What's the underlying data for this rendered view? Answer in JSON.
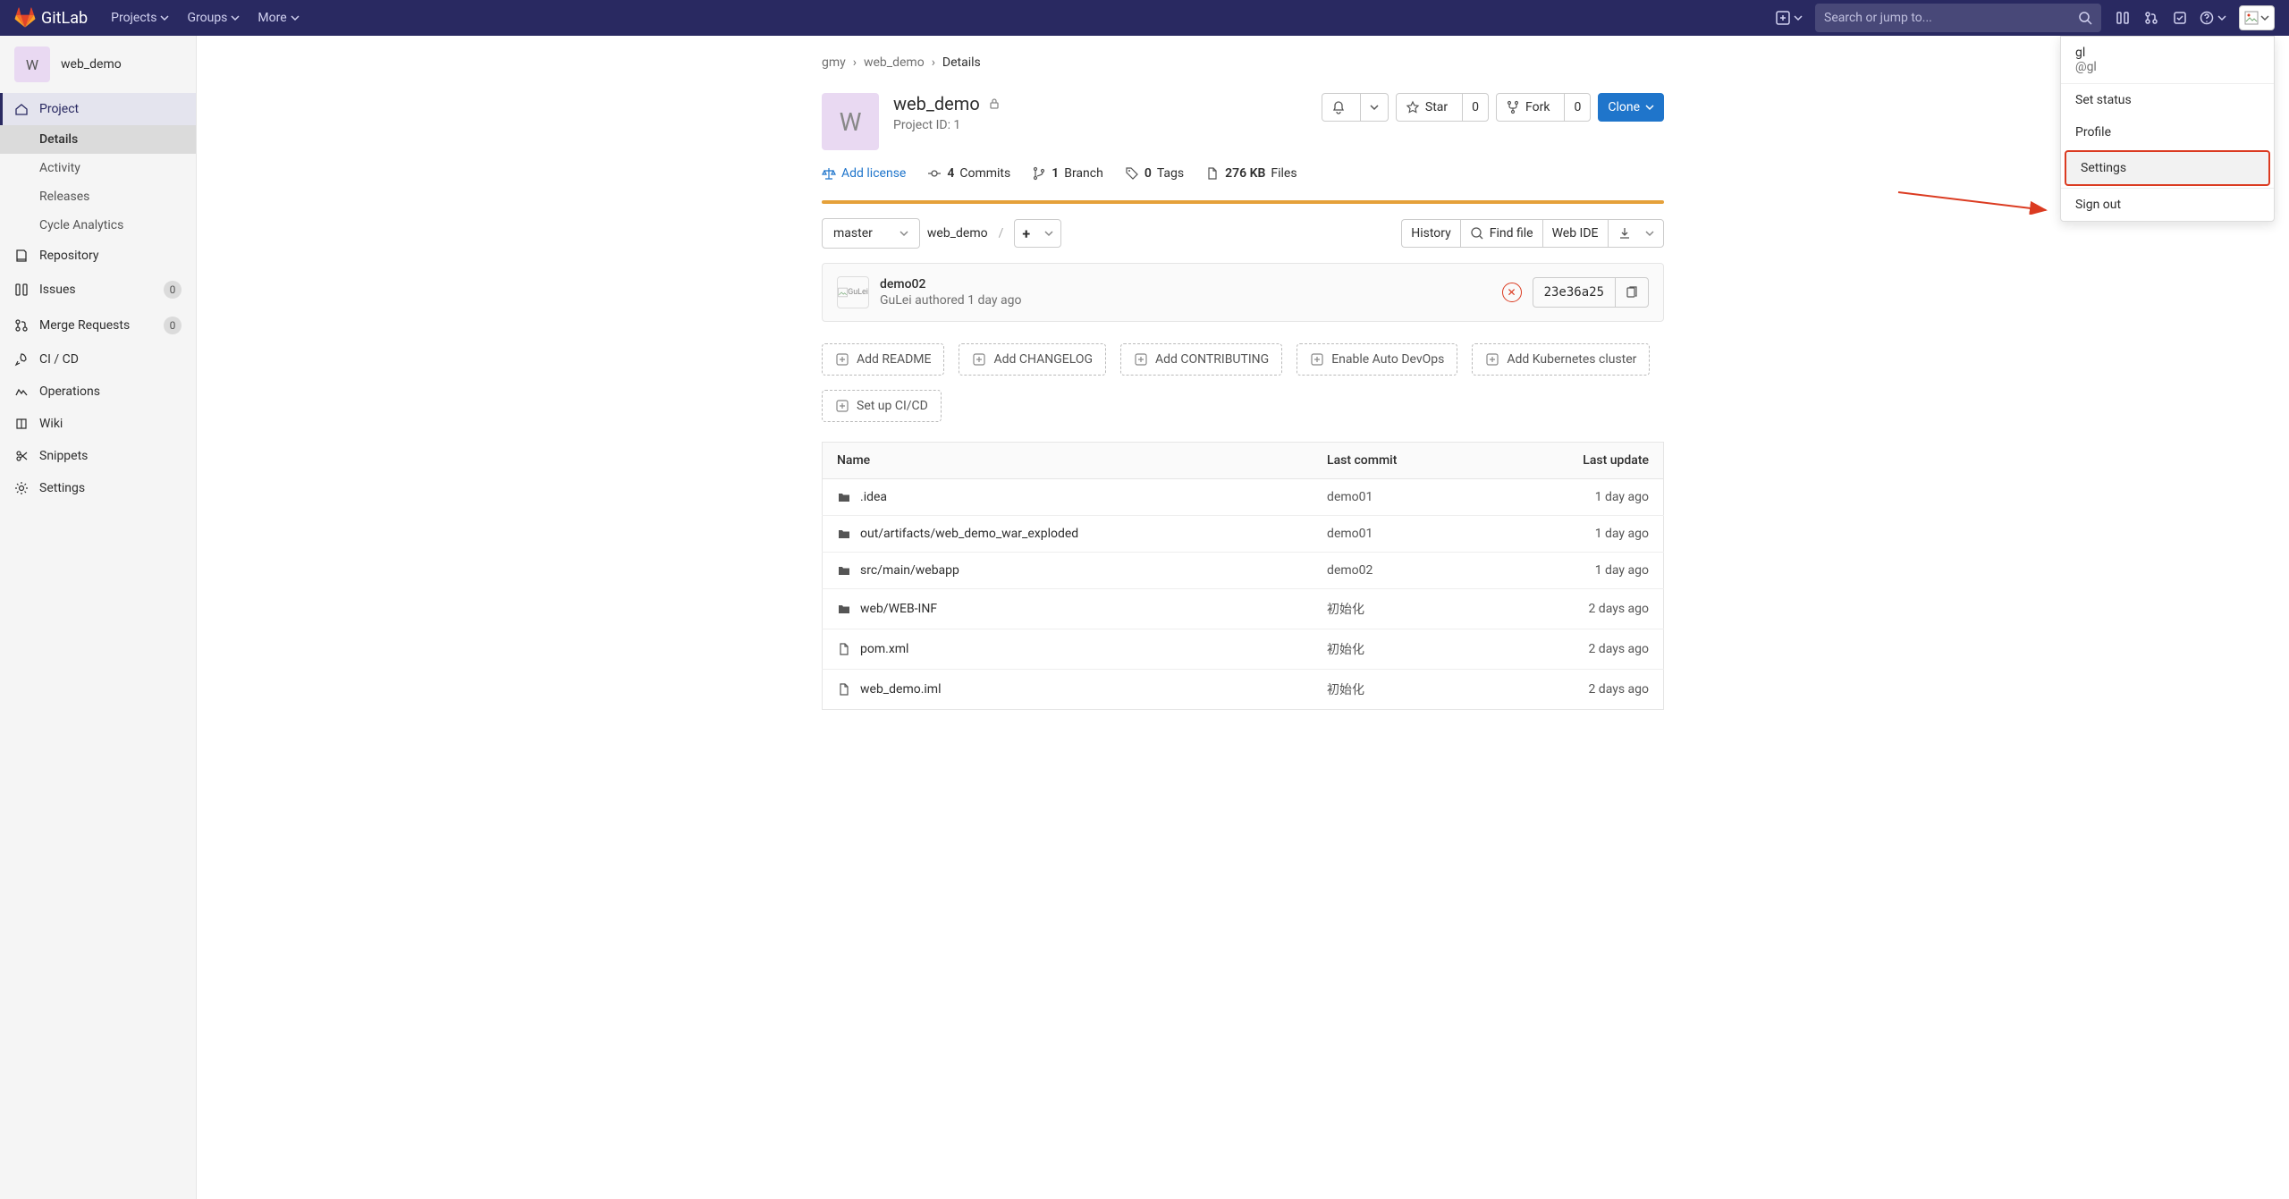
{
  "topnav": {
    "brand": "GitLab",
    "items": [
      "Projects",
      "Groups",
      "More"
    ],
    "search_placeholder": "Search or jump to..."
  },
  "sidebar": {
    "project_initial": "W",
    "project_name": "web_demo",
    "groups": [
      {
        "icon": "home",
        "label": "Project",
        "active": true,
        "subs": [
          {
            "label": "Details",
            "active": true
          },
          {
            "label": "Activity"
          },
          {
            "label": "Releases"
          },
          {
            "label": "Cycle Analytics"
          }
        ]
      },
      {
        "icon": "repo",
        "label": "Repository"
      },
      {
        "icon": "issues",
        "label": "Issues",
        "count": "0"
      },
      {
        "icon": "mr",
        "label": "Merge Requests",
        "count": "0"
      },
      {
        "icon": "rocket",
        "label": "CI / CD"
      },
      {
        "icon": "ops",
        "label": "Operations"
      },
      {
        "icon": "book",
        "label": "Wiki"
      },
      {
        "icon": "scissors",
        "label": "Snippets"
      },
      {
        "icon": "gear",
        "label": "Settings"
      }
    ]
  },
  "breadcrumbs": {
    "a": "gmy",
    "b": "web_demo",
    "c": "Details"
  },
  "hero": {
    "initial": "W",
    "title": "web_demo",
    "project_id": "Project ID: 1",
    "star": "Star",
    "star_count": "0",
    "fork": "Fork",
    "fork_count": "0",
    "clone": "Clone"
  },
  "stats": {
    "add_license": "Add license",
    "commits_n": "4",
    "commits_w": "Commits",
    "branch_n": "1",
    "branch_w": "Branch",
    "tags_n": "0",
    "tags_w": "Tags",
    "size_n": "276 KB",
    "size_w": "Files"
  },
  "toolbar": {
    "branch": "master",
    "project": "web_demo",
    "history": "History",
    "find": "Find file",
    "ide": "Web IDE"
  },
  "commit": {
    "title": "demo02",
    "author": "GuLei",
    "authored": "authored",
    "time": "1 day ago",
    "avatar_alt": "GuLei",
    "sha": "23e36a25"
  },
  "chips": [
    "Add README",
    "Add CHANGELOG",
    "Add CONTRIBUTING",
    "Enable Auto DevOps",
    "Add Kubernetes cluster",
    "Set up CI/CD"
  ],
  "table": {
    "cols": [
      "Name",
      "Last commit",
      "Last update"
    ],
    "rows": [
      {
        "icon": "folder",
        "name": ".idea",
        "commit": "demo01",
        "update": "1 day ago"
      },
      {
        "icon": "folder",
        "name": "out/artifacts/web_demo_war_exploded",
        "commit": "demo01",
        "update": "1 day ago"
      },
      {
        "icon": "folder",
        "name": "src/main/webapp",
        "commit": "demo02",
        "update": "1 day ago"
      },
      {
        "icon": "folder",
        "name": "web/WEB-INF",
        "commit": "初始化",
        "update": "2 days ago"
      },
      {
        "icon": "file",
        "name": "pom.xml",
        "commit": "初始化",
        "update": "2 days ago"
      },
      {
        "icon": "file",
        "name": "web_demo.iml",
        "commit": "初始化",
        "update": "2 days ago"
      }
    ]
  },
  "user_menu": {
    "name": "gl",
    "handle": "@gl",
    "items": [
      "Set status",
      "Profile",
      "Settings",
      "Sign out"
    ],
    "highlight_index": 2
  }
}
